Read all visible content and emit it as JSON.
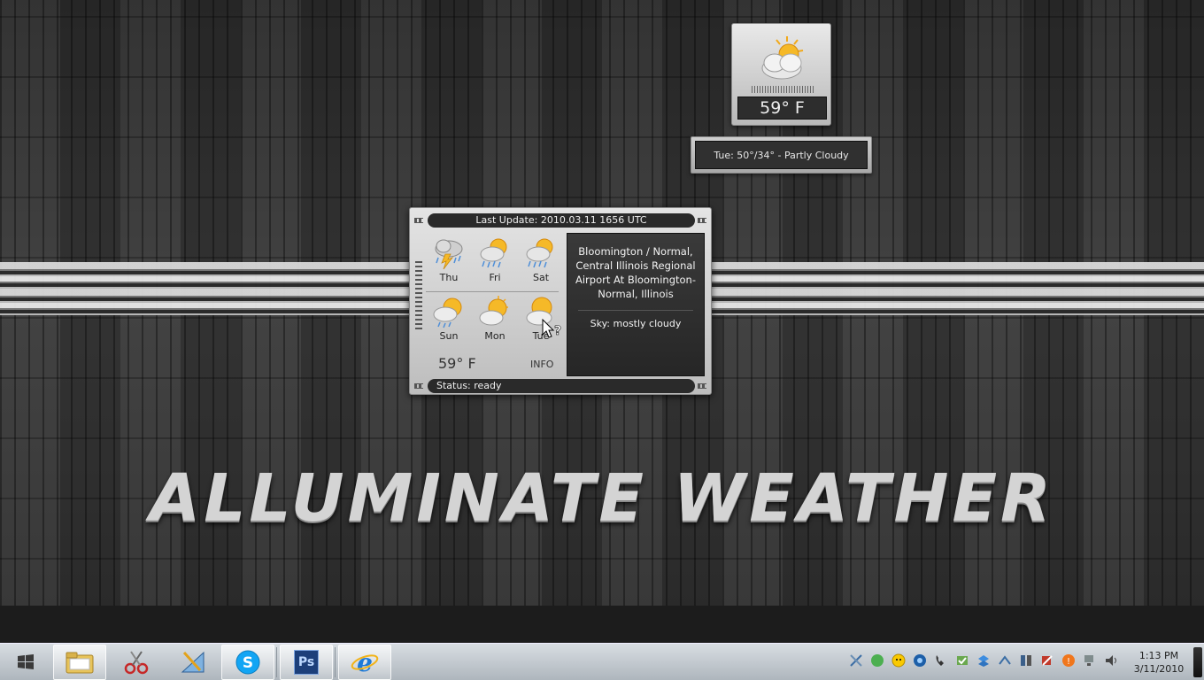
{
  "wallpaper": {
    "title": "ALLUMINATE WEATHER"
  },
  "mini_widget": {
    "temperature": "59° F",
    "forecast": "Tue: 50°/34° - Partly Cloudy"
  },
  "gadget": {
    "last_update": "Last Update:  2010.03.11 1656 UTC",
    "status": "Status: ready",
    "temperature": "59° F",
    "info_label": "INFO",
    "forecast_days": [
      {
        "day": "Thu",
        "icon": "thunderstorm-icon"
      },
      {
        "day": "Fri",
        "icon": "sun-rain-icon"
      },
      {
        "day": "Sat",
        "icon": "sun-rain-icon"
      },
      {
        "day": "Sun",
        "icon": "sun-cloud-rain-icon"
      },
      {
        "day": "Mon",
        "icon": "partly-sunny-icon"
      },
      {
        "day": "Tue",
        "icon": "partly-cloudy-icon"
      }
    ],
    "station": "Bloomington / Normal, Central Illinois Regional Airport At Bloomington-Normal, Illinois",
    "sky": "Sky: mostly cloudy"
  },
  "taskbar": {
    "apps": [
      {
        "name": "windows-explorer"
      },
      {
        "name": "snipping-tool"
      },
      {
        "name": "design-tool"
      },
      {
        "name": "skype"
      },
      {
        "name": "photoshop",
        "label": "Ps"
      },
      {
        "name": "internet-explorer"
      }
    ],
    "clock_time": "1:13 PM",
    "clock_date": "3/11/2010"
  },
  "colors": {
    "accent_sun": "#f5b928",
    "panel_dark": "#2a2a2a",
    "metal_light": "#e4e4e4"
  }
}
